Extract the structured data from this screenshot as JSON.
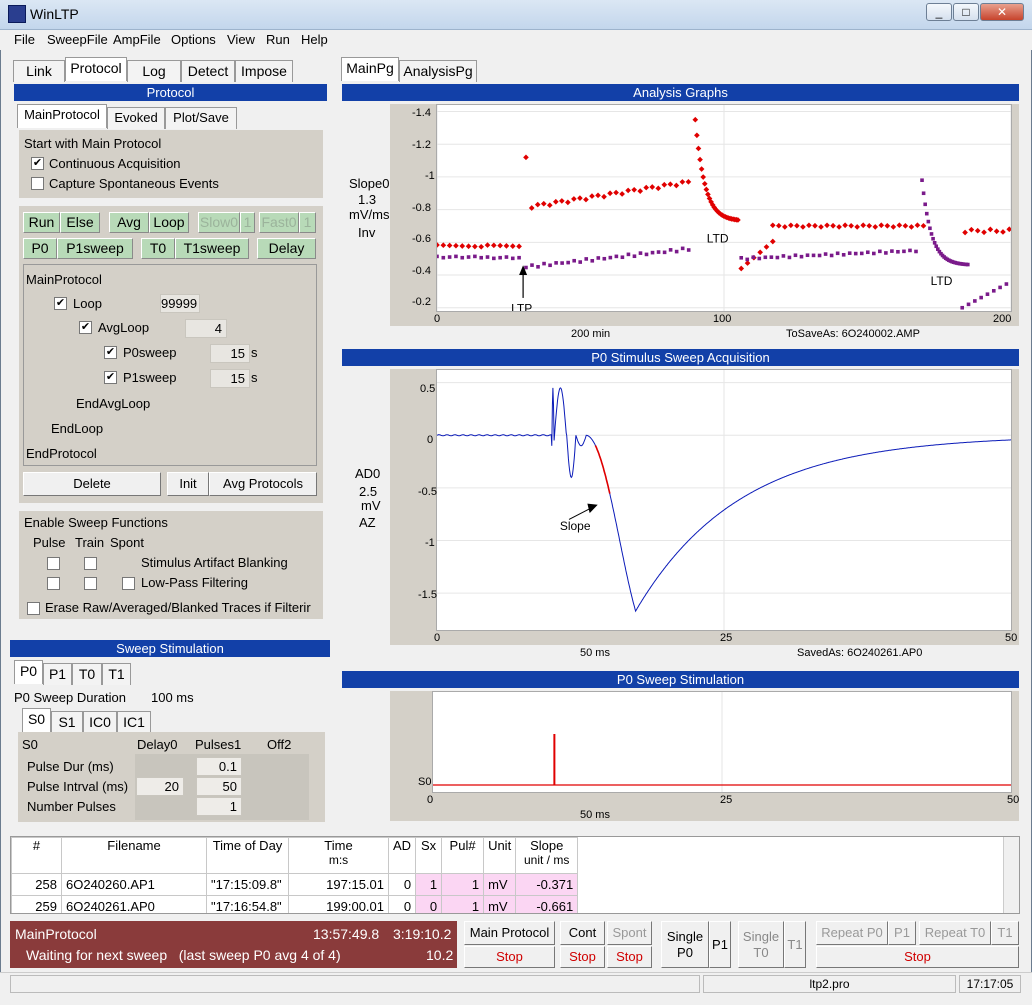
{
  "window": {
    "title": "WinLTP",
    "controls": [
      "_",
      "□",
      "✕"
    ]
  },
  "menu": [
    "File",
    "SweepFile",
    "AmpFile",
    "Options",
    "View",
    "Run",
    "Help"
  ],
  "left_tabs": [
    "Link",
    "Protocol",
    "Log",
    "Detect",
    "Impose"
  ],
  "protocol": {
    "header": "Protocol",
    "subtabs": [
      "MainProtocol",
      "Evoked",
      "Plot/Save"
    ],
    "start_label": "Start with Main Protocol",
    "continuous": "Continuous Acquisition",
    "capture": "Capture Spontaneous Events",
    "btn_run": "Run",
    "btn_else": "Else",
    "btn_avg": "Avg",
    "btn_loop": "Loop",
    "btn_slow0": "Slow0",
    "btn_slow1": "1",
    "btn_fast0": "Fast0",
    "btn_fast1": "1",
    "btn_p0": "P0",
    "btn_p1sweep": "P1sweep",
    "btn_t0": "T0",
    "btn_t1sweep": "T1sweep",
    "btn_delay": "Delay",
    "tree": {
      "main": "MainProtocol",
      "loop": "Loop",
      "loop_val": "99999",
      "avgloop": "AvgLoop",
      "avgloop_val": "4",
      "p0sweep": "P0sweep",
      "p0_val": "15",
      "p1sweep": "P1sweep",
      "p1_val": "15",
      "unit_s": "s",
      "endavg": "EndAvgLoop",
      "endloop": "EndLoop",
      "endprot": "EndProtocol"
    },
    "btn_delete": "Delete",
    "btn_init": "Init",
    "btn_avgprot": "Avg Protocols",
    "enable_label": "Enable Sweep Functions",
    "col_pulse": "Pulse",
    "col_train": "Train",
    "col_spont": "Spont",
    "artifact": "Stimulus Artifact Blanking",
    "lowpass": "Low-Pass Filtering",
    "erase": "Erase Raw/Averaged/Blanked Traces if Filterir"
  },
  "sweep_stim": {
    "header": "Sweep Stimulation",
    "tabs": [
      "P0",
      "P1",
      "T0",
      "T1"
    ],
    "duration_label": "P0 Sweep Duration",
    "duration_val": "100 ms",
    "subtabs": [
      "S0",
      "S1",
      "IC0",
      "IC1"
    ],
    "cols": [
      "S0",
      "Delay0",
      "Pulses1",
      "Off2"
    ],
    "rows": [
      {
        "label": "Pulse Dur (ms)",
        "delay": "",
        "pulses": "0.1"
      },
      {
        "label": "Pulse Intrval (ms)",
        "delay": "20",
        "pulses": "50"
      },
      {
        "label": "Number Pulses",
        "delay": "",
        "pulses": "1"
      }
    ]
  },
  "right_tabs": [
    "MainPg",
    "AnalysisPg"
  ],
  "analysis": {
    "header": "Analysis Graphs",
    "side": [
      "Slope0",
      "1.3",
      "mV/ms",
      "Inv"
    ],
    "yticks": [
      "-1.4",
      "-1.2",
      "-1",
      "-0.8",
      "-0.6",
      "-0.4",
      "-0.2"
    ],
    "xticks": [
      "0",
      "100",
      "200"
    ],
    "xinfo": "200 min",
    "save": "ToSaveAs: 6O240002.AMP",
    "annotations": [
      "LTP",
      "LTD",
      "LTD"
    ],
    "colors": {
      "red": "#e00000",
      "purple": "#7a1a8a"
    }
  },
  "acq": {
    "header": "P0 Stimulus Sweep Acquisition",
    "side": [
      "AD0",
      "2.5",
      "mV",
      "AZ"
    ],
    "yticks": [
      "0.5",
      "0",
      "-0.5",
      "-1",
      "-1.5"
    ],
    "xticks": [
      "0",
      "25",
      "50"
    ],
    "xinfo": "50 ms",
    "saved": "SavedAs: 6O240261.AP0",
    "annotation": "Slope"
  },
  "stim": {
    "header": "P0 Sweep Stimulation",
    "ylabel": "S0",
    "xticks": [
      "0",
      "25",
      "50"
    ],
    "xinfo": "50 ms"
  },
  "table": {
    "headers": [
      "#",
      "Filename",
      "Time of Day",
      "Time",
      "AD",
      "Sx",
      "Pul#",
      "Unit",
      "Slope"
    ],
    "subheaders": [
      "",
      "",
      "",
      "m:s",
      "",
      "",
      "",
      "",
      "unit / ms"
    ],
    "rows": [
      [
        "258",
        "6O240260.AP1",
        "\"17:15:09.8\"",
        "197:15.01",
        "0",
        "1",
        "1",
        "mV",
        "-0.371"
      ],
      [
        "259",
        "6O240261.AP0",
        "\"17:16:54.8\"",
        "199:00.01",
        "0",
        "0",
        "1",
        "mV",
        "-0.661"
      ]
    ]
  },
  "status": {
    "protocol": "MainProtocol",
    "time1": "13:57:49.8",
    "time2": "3:19:10.2",
    "message": "Waiting for next sweep   (last sweep P0 avg 4 of 4)",
    "value": "10.2"
  },
  "bottom_buttons": {
    "main_protocol": "Main Protocol",
    "cont": "Cont",
    "spont": "Spont",
    "stop": "Stop",
    "single_p0_a": "Single",
    "single_p0_b": "P0",
    "p1": "P1",
    "single_t0_a": "Single",
    "single_t0_b": "T0",
    "t1": "T1",
    "repeat_p0": "Repeat P0",
    "rp1": "P1",
    "repeat_t0": "Repeat T0",
    "rt1": "T1"
  },
  "statusbar": {
    "file": "ltp2.pro",
    "clock": "17:17:05"
  }
}
